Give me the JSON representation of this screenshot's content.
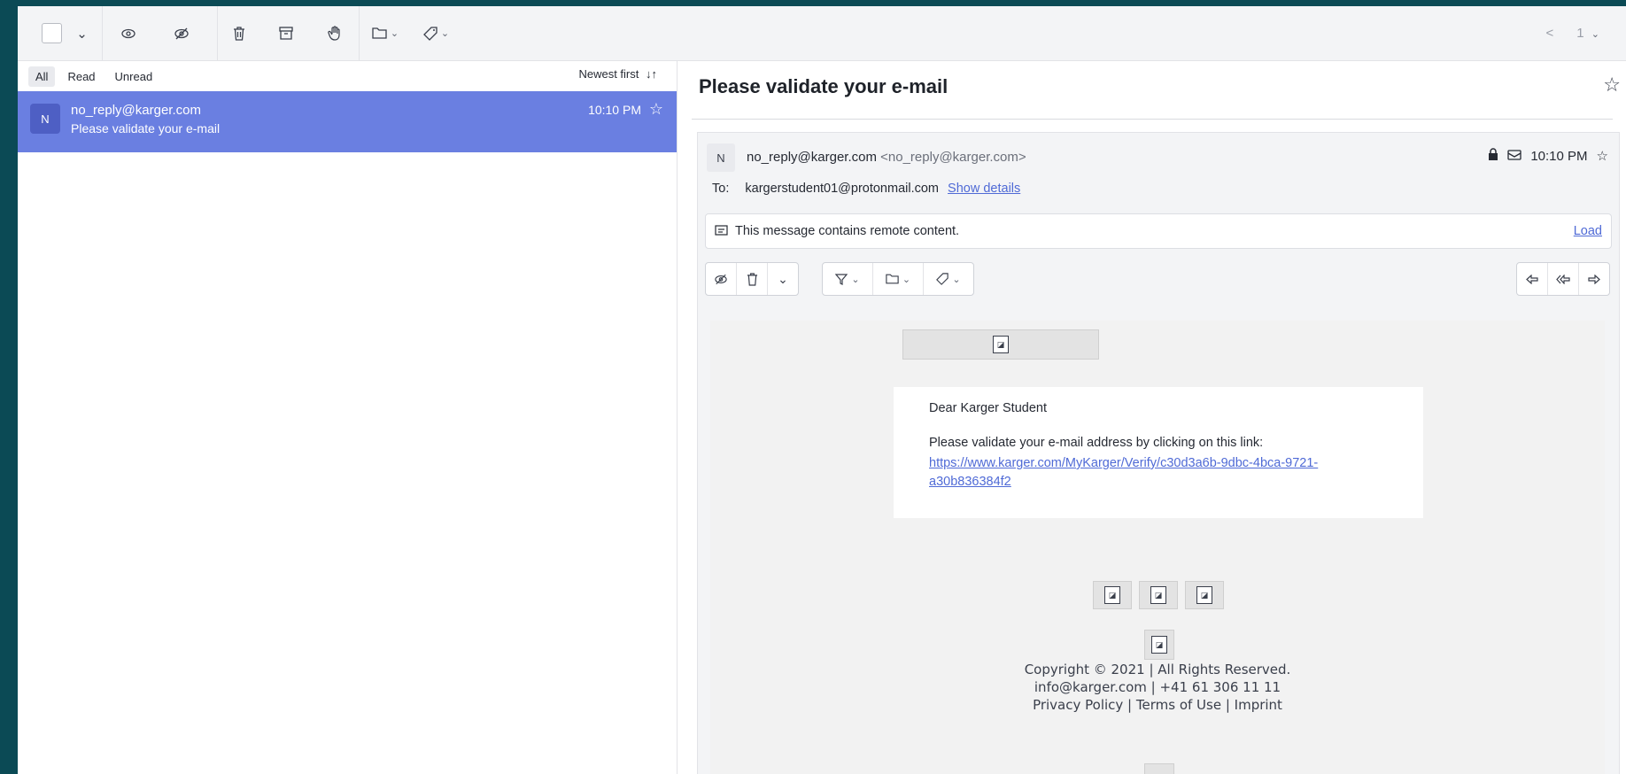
{
  "toolbar": {
    "icons": [
      "checkbox",
      "chevron-down-icon",
      "eye-icon",
      "eye-slash-icon",
      "trash-icon",
      "archive-icon",
      "hand-icon",
      "folder-icon",
      "tag-icon"
    ],
    "pager_prev": "<",
    "pager_page": "1"
  },
  "list": {
    "filters": [
      "All",
      "Read",
      "Unread"
    ],
    "active_filter": "All",
    "sort_label": "Newest first",
    "items": [
      {
        "avatar": "N",
        "from": "no_reply@karger.com",
        "subject": "Please validate your e-mail",
        "time": "10:10 PM",
        "selected": true
      }
    ]
  },
  "message": {
    "subject": "Please validate your e-mail",
    "sender_avatar": "N",
    "sender_name": "no_reply@karger.com",
    "sender_address": "<no_reply@karger.com>",
    "time": "10:10 PM",
    "to_label": "To:",
    "to_address": "kargerstudent01@protonmail.com",
    "show_details": "Show details",
    "remote_notice": "This message contains remote content.",
    "load_label": "Load",
    "body": {
      "greeting": "Dear Karger Student",
      "instruction": "Please validate your e-mail address by clicking on this link:",
      "link": "https://www.karger.com/MyKarger/Verify/c30d3a6b-9dbc-4bca-9721-a30b836384f2",
      "footer_line1": "Copyright © 2021 | All Rights Reserved.",
      "footer_line2": "info@karger.com | +41 61 306 11 11",
      "footer_line3": "Privacy Policy | Terms of Use | Imprint"
    }
  },
  "colors": {
    "selected_row": "#6a7fe1",
    "link": "#4f6ad6",
    "frame": "#0b4a55"
  }
}
